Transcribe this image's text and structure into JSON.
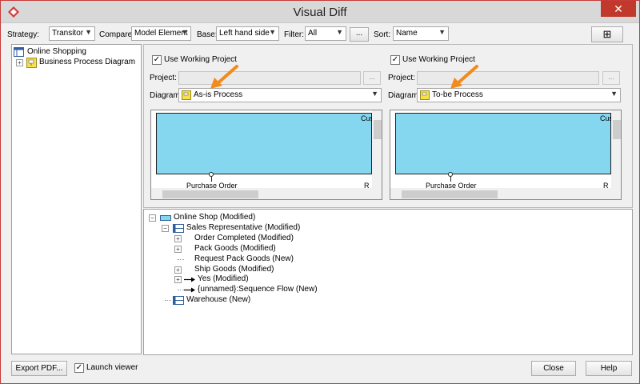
{
  "window": {
    "title": "Visual Diff",
    "close_glyph": "✕"
  },
  "toolbar": {
    "strategy_label": "Strategy:",
    "strategy_value": "Transitor",
    "compare_label": "Compare:",
    "compare_value": "Model Element",
    "base_label": "Base:",
    "base_value": "Left hand side",
    "filter_label": "Filter:",
    "filter_value": "All",
    "filter_more": "...",
    "sort_label": "Sort:",
    "sort_value": "Name",
    "add_glyph": "⊞"
  },
  "model_tree": {
    "root": "Online Shopping",
    "child": "Business Process Diagram"
  },
  "left_side": {
    "use_working_project": "Use Working Project",
    "project_label": "Project:",
    "browse": "...",
    "diagram_label": "Diagram:",
    "diagram_value": "As-is Process",
    "preview_label_bottom": "Purchase Order",
    "preview_label_corner": "Cus",
    "preview_label_br": "R"
  },
  "right_side": {
    "use_working_project": "Use Working Project",
    "project_label": "Project:",
    "browse": "...",
    "diagram_label": "Diagram:",
    "diagram_value": "To-be Process",
    "preview_label_bottom": "Purchase Order",
    "preview_label_corner": "Cus",
    "preview_label_br": "R"
  },
  "diff_tree": [
    {
      "label": "Online Shop (Modified)",
      "indent": 0,
      "expander": "minus",
      "icon": "pool"
    },
    {
      "label": "Sales Representative (Modified)",
      "indent": 1,
      "expander": "minus",
      "icon": "lane"
    },
    {
      "label": "Order Completed (Modified)",
      "indent": 2,
      "expander": "plus",
      "icon": "none"
    },
    {
      "label": "Pack Goods (Modified)",
      "indent": 2,
      "expander": "plus",
      "icon": "none"
    },
    {
      "label": "Request Pack Goods (New)",
      "indent": 2,
      "expander": "none",
      "icon": "none"
    },
    {
      "label": "Ship Goods (Modified)",
      "indent": 2,
      "expander": "plus",
      "icon": "none"
    },
    {
      "label": "Yes (Modified)",
      "indent": 2,
      "expander": "plus",
      "icon": "arrow"
    },
    {
      "label": "{unnamed}:Sequence Flow (New)",
      "indent": 2,
      "expander": "none",
      "icon": "arrow"
    },
    {
      "label": "Warehouse (New)",
      "indent": 1,
      "expander": "none",
      "icon": "lane"
    }
  ],
  "footer": {
    "export_pdf": "Export PDF...",
    "launch_viewer": "Launch viewer",
    "close": "Close",
    "help": "Help"
  },
  "colors": {
    "lane_fill": "#84d7ef",
    "accent_arrow": "#f28a1e",
    "close_red": "#c0392b"
  }
}
